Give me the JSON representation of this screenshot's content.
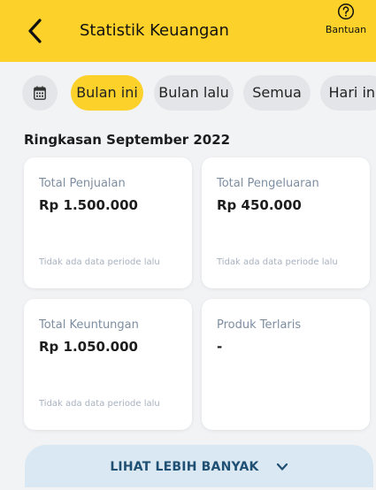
{
  "header": {
    "title": "Statistik Keuangan",
    "help_label": "Bantuan",
    "background": "#fcd12a"
  },
  "filters": {
    "calendar_icon": "calendar-icon",
    "chips": [
      {
        "label": "Bulan ini",
        "active": true
      },
      {
        "label": "Bulan lalu",
        "active": false
      },
      {
        "label": "Semua",
        "active": false
      },
      {
        "label": "Hari ini",
        "active": false
      }
    ]
  },
  "summary": {
    "title": "Ringkasan September 2022",
    "cards": [
      {
        "label": "Total Penjualan",
        "value": "Rp 1.500.000",
        "note": "Tidak ada data periode lalu"
      },
      {
        "label": "Total Pengeluaran",
        "value": "Rp 450.000",
        "note": "Tidak ada data periode lalu"
      },
      {
        "label": "Total Keuntungan",
        "value": "Rp 1.050.000",
        "note": "Tidak ada data periode lalu"
      },
      {
        "label": "Produk Terlaris",
        "value": "-",
        "note": ""
      }
    ]
  },
  "more_button": {
    "label": "LIHAT LEBIH BANYAK",
    "icon": "chevron-down-icon"
  },
  "colors": {
    "accent": "#fcd12a",
    "chip_bg": "#e4e5e8",
    "card_label": "#7d8ea2",
    "more_bg": "#d9e8f2",
    "more_text": "#1f4f72"
  }
}
